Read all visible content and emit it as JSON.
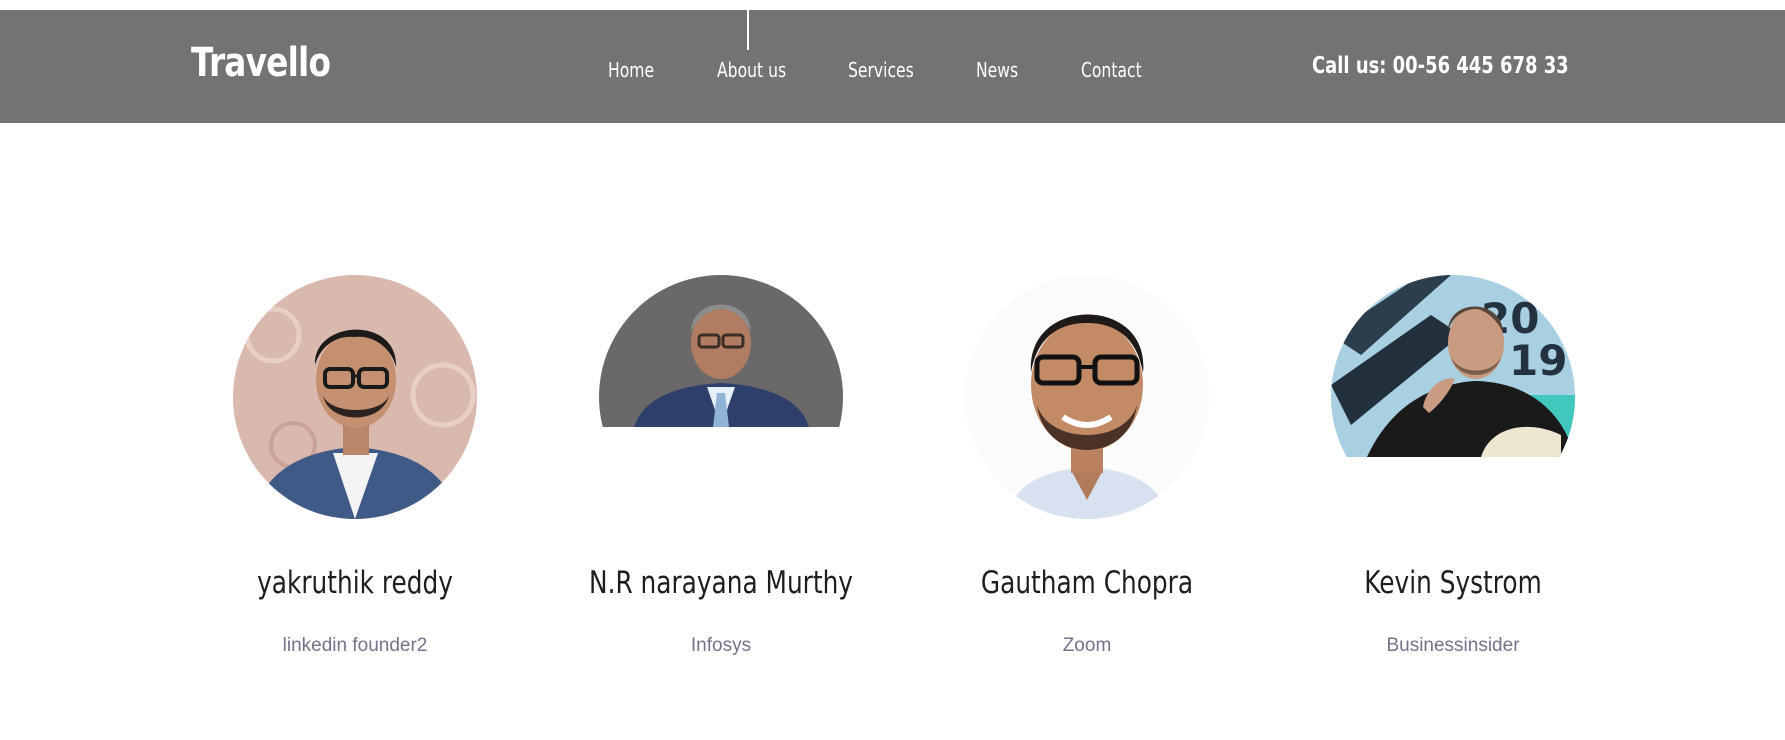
{
  "header": {
    "logo": "Travello",
    "nav": [
      {
        "label": "Home"
      },
      {
        "label": "About us"
      },
      {
        "label": "Services"
      },
      {
        "label": "News"
      },
      {
        "label": "Contact"
      }
    ],
    "phone": "Call us: 00-56 445 678 33",
    "background_color": "#737373"
  },
  "team": [
    {
      "name": "yakruthik reddy",
      "company": "linkedin founder2"
    },
    {
      "name": "N.R narayana Murthy",
      "company": "Infosys"
    },
    {
      "name": "Gautham Chopra",
      "company": "Zoom"
    },
    {
      "name": "Kevin Systrom",
      "company": "Businessinsider"
    }
  ]
}
